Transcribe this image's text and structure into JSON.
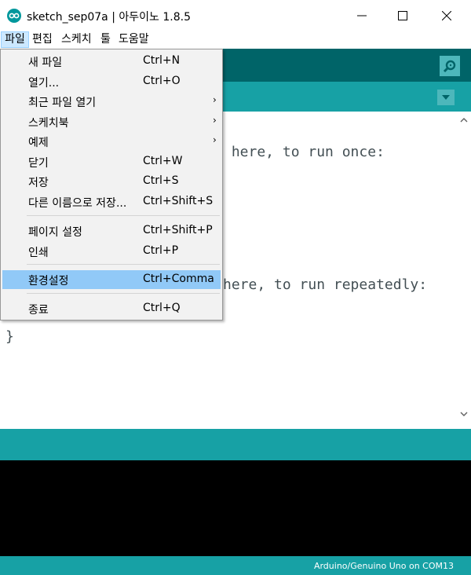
{
  "window": {
    "title": "sketch_sep07a | 아두이노 1.8.5"
  },
  "menubar": {
    "file": "파일",
    "edit": "편집",
    "sketch": "스케치",
    "tools": "툴",
    "help": "도움말"
  },
  "file_menu": {
    "items": [
      {
        "label": "새 파일",
        "shortcut": "Ctrl+N"
      },
      {
        "label": "열기...",
        "shortcut": "Ctrl+O"
      },
      {
        "label": "최근 파일 열기",
        "submenu": true
      },
      {
        "label": "스케치북",
        "submenu": true
      },
      {
        "label": "예제",
        "submenu": true
      },
      {
        "label": "닫기",
        "shortcut": "Ctrl+W"
      },
      {
        "label": "저장",
        "shortcut": "Ctrl+S"
      },
      {
        "label": "다른 이름으로 저장...",
        "shortcut": "Ctrl+Shift+S"
      },
      {
        "label": "페이지 설정",
        "shortcut": "Ctrl+Shift+P"
      },
      {
        "label": "인쇄",
        "shortcut": "Ctrl+P"
      },
      {
        "label": "환경설정",
        "shortcut": "Ctrl+Comma",
        "highlighted": true
      },
      {
        "label": "종료",
        "shortcut": "Ctrl+Q"
      }
    ],
    "submenu_arrow": "›"
  },
  "editor": {
    "lines": [
      " here, to run once:",
      "here, to run repeatedly:",
      "}"
    ]
  },
  "footer": {
    "board_info": "Arduino/Genuino Uno on COM13"
  },
  "colors": {
    "toolbar": "#006468",
    "tabbar": "#17a1a5",
    "console": "#000000",
    "highlight": "#91c9f7"
  },
  "icons": {
    "app": "arduino-infinity-icon",
    "serial_monitor": "magnifier-icon",
    "tab_menu": "triangle-down-icon"
  }
}
